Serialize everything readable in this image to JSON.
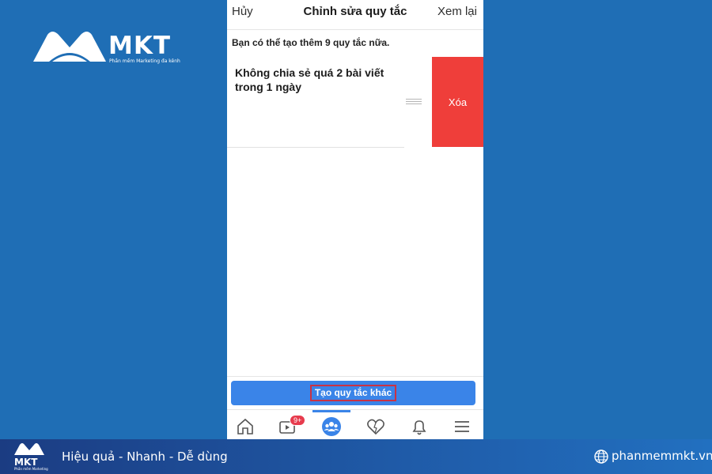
{
  "brand": {
    "name": "MKT",
    "tagline": "Phần mềm Marketing đa kênh",
    "footer_tagline": "Phần mềm Marketing",
    "slogan": "Hiệu quả - Nhanh  - Dễ dùng",
    "website": "phanmemmkt.vn"
  },
  "nav": {
    "cancel_label": "Hủy",
    "title": "Chỉnh sửa quy tắc",
    "review_label": "Xem lại"
  },
  "info_text": "Bạn có thể tạo thêm 9 quy tắc nữa.",
  "rule": {
    "text": "Không chia sẻ quá 2 bài viết trong 1 ngày",
    "delete_label": "Xóa"
  },
  "create_button_label": "Tạo quy tắc khác",
  "tabbar": {
    "tabs": [
      "home-icon",
      "video-icon",
      "groups-icon",
      "dating-heart-icon",
      "bell-icon",
      "menu-icon"
    ],
    "video_badge": "9+",
    "active_tab": "groups-icon"
  },
  "colors": {
    "background": "#1f6eb5",
    "delete_red": "#ef3e3a",
    "button_blue": "#3a84e8",
    "highlight_outline": "#c93244",
    "badge_red": "#e73b4d"
  }
}
